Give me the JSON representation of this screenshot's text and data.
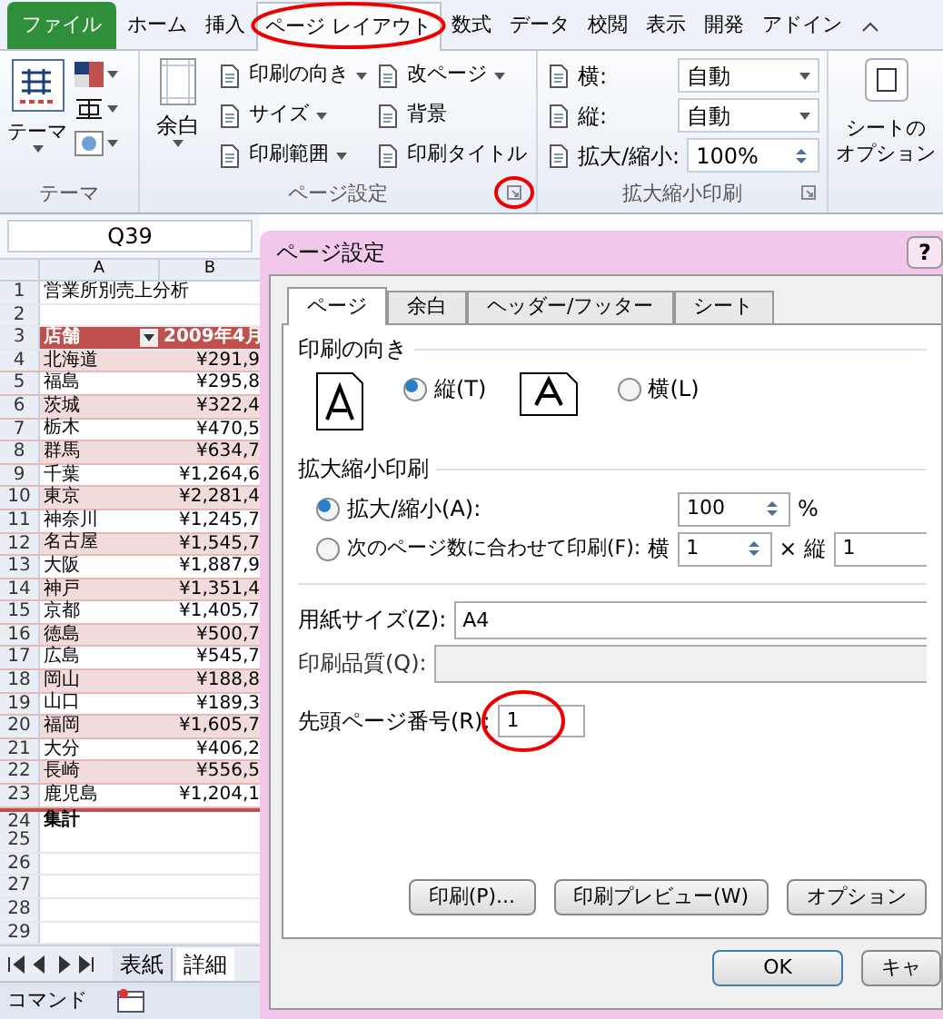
{
  "ribbon_tabs": [
    {
      "label": "ファイル",
      "kind": "file",
      "selected": false,
      "circled": false
    },
    {
      "label": "ホーム",
      "kind": "tab",
      "selected": false,
      "circled": false
    },
    {
      "label": "挿入",
      "kind": "tab",
      "selected": false,
      "circled": false
    },
    {
      "label": "ページ レイアウト",
      "kind": "tab",
      "selected": true,
      "circled": true
    },
    {
      "label": "数式",
      "kind": "tab",
      "selected": false,
      "circled": false
    },
    {
      "label": "データ",
      "kind": "tab",
      "selected": false,
      "circled": false
    },
    {
      "label": "校閲",
      "kind": "tab",
      "selected": false,
      "circled": false
    },
    {
      "label": "表示",
      "kind": "tab",
      "selected": false,
      "circled": false
    },
    {
      "label": "開発",
      "kind": "tab",
      "selected": false,
      "circled": false
    },
    {
      "label": "アドイン",
      "kind": "tab",
      "selected": false,
      "circled": false
    }
  ],
  "ribbon": {
    "theme_group": {
      "button": "テーマ",
      "label": "テーマ"
    },
    "page_setup_group": {
      "margins": "余白",
      "commands": [
        "印刷の向き",
        "サイズ",
        "印刷範囲"
      ],
      "commands_2": [
        "改ページ",
        "背景",
        "印刷タイトル"
      ],
      "label": "ページ設定",
      "launcher_circled": true
    },
    "scale_group": {
      "width_label": "横:",
      "width_value": "自動",
      "height_label": "縦:",
      "height_value": "自動",
      "scale_label": "拡大/縮小:",
      "scale_value": "100%",
      "label": "拡大縮小印刷"
    },
    "sheet_options": [
      "シートの",
      "オプション"
    ]
  },
  "name_box": "Q39",
  "sheet": {
    "columns": [
      "A",
      "B"
    ],
    "rows": [
      {
        "num": "1",
        "a": "営業所別売上分析"
      },
      {
        "num": "2"
      },
      {
        "num": "3",
        "a": "店舗",
        "b": "2009年4月",
        "kind": "header"
      },
      {
        "num": "4",
        "a": "北海道",
        "b": "¥291,9"
      },
      {
        "num": "5",
        "a": "福島",
        "b": "¥295,8"
      },
      {
        "num": "6",
        "a": "茨城",
        "b": "¥322,4"
      },
      {
        "num": "7",
        "a": "栃木",
        "b": "¥470,5"
      },
      {
        "num": "8",
        "a": "群馬",
        "b": "¥634,7"
      },
      {
        "num": "9",
        "a": "千葉",
        "b": "¥1,264,6"
      },
      {
        "num": "10",
        "a": "東京",
        "b": "¥2,281,4"
      },
      {
        "num": "11",
        "a": "神奈川",
        "b": "¥1,245,7"
      },
      {
        "num": "12",
        "a": "名古屋",
        "b": "¥1,545,7"
      },
      {
        "num": "13",
        "a": "大阪",
        "b": "¥1,887,9"
      },
      {
        "num": "14",
        "a": "神戸",
        "b": "¥1,351,4"
      },
      {
        "num": "15",
        "a": "京都",
        "b": "¥1,405,7"
      },
      {
        "num": "16",
        "a": "徳島",
        "b": "¥500,7"
      },
      {
        "num": "17",
        "a": "広島",
        "b": "¥545,7"
      },
      {
        "num": "18",
        "a": "岡山",
        "b": "¥188,8"
      },
      {
        "num": "19",
        "a": "山口",
        "b": "¥189,3"
      },
      {
        "num": "20",
        "a": "福岡",
        "b": "¥1,605,7"
      },
      {
        "num": "21",
        "a": "大分",
        "b": "¥406,2"
      },
      {
        "num": "22",
        "a": "長崎",
        "b": "¥556,5"
      },
      {
        "num": "23",
        "a": "鹿児島",
        "b": "¥1,204,1"
      },
      {
        "num": "24",
        "a": "集計",
        "kind": "total"
      },
      {
        "num": "25"
      },
      {
        "num": "26"
      },
      {
        "num": "27"
      },
      {
        "num": "28"
      },
      {
        "num": "29"
      }
    ],
    "sheet_tabs": [
      {
        "label": "表紙",
        "selected": false
      },
      {
        "label": "詳細",
        "selected": true
      }
    ]
  },
  "status_bar": {
    "mode": "コマンド"
  },
  "dialog": {
    "title": "ページ設定",
    "help": "?",
    "tabs": [
      {
        "label": "ページ",
        "selected": true
      },
      {
        "label": "余白",
        "selected": false
      },
      {
        "label": "ヘッダー/フッター",
        "selected": false
      },
      {
        "label": "シート",
        "selected": false
      }
    ],
    "orientation": {
      "title": "印刷の向き",
      "options": [
        {
          "label": "縦(T)",
          "kind": "portrait",
          "selected": true
        },
        {
          "label": "横(L)",
          "kind": "landscape",
          "selected": false
        }
      ]
    },
    "scaling": {
      "title": "拡大縮小印刷",
      "scale": {
        "label": "拡大/縮小(A):",
        "selected": true,
        "value": "100",
        "unit": "%"
      },
      "fit": {
        "label": "次のページ数に合わせて印刷(F):",
        "selected": false,
        "wide_label": "横",
        "wide_value": "1",
        "times": "×",
        "tall_label": "縦",
        "tall_value": "1"
      }
    },
    "paper_size": {
      "label": "用紙サイズ(Z):",
      "value": "A4"
    },
    "print_quality": {
      "label": "印刷品質(Q):",
      "disabled": true
    },
    "first_page": {
      "label": "先頭ページ番号(R):",
      "value": "1",
      "circled": true
    },
    "buttons": [
      "印刷(P)...",
      "印刷プレビュー(W)",
      "オプション"
    ],
    "footer_buttons": [
      "OK",
      "キャ"
    ]
  }
}
